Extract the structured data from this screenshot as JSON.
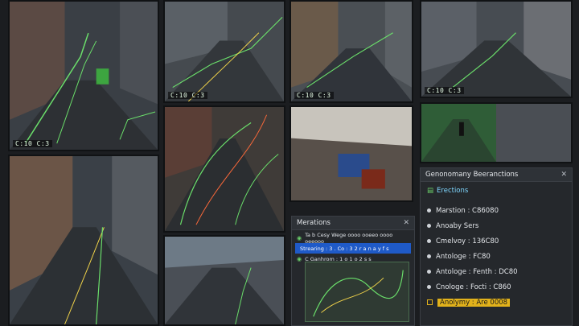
{
  "feeds": [
    {
      "id": "feed-1",
      "timestamp": "C:10 C:3",
      "label": ""
    },
    {
      "id": "feed-2",
      "timestamp": "C:10 C:3",
      "label": ""
    },
    {
      "id": "feed-3",
      "timestamp": "C:10 C:3",
      "label": ""
    },
    {
      "id": "feed-4",
      "timestamp": "C:10 C:3",
      "label": ""
    },
    {
      "id": "feed-5",
      "timestamp": "",
      "label": ""
    },
    {
      "id": "feed-6",
      "timestamp": "",
      "label": ""
    },
    {
      "id": "feed-7",
      "timestamp": "",
      "label": ""
    },
    {
      "id": "feed-8",
      "timestamp": "",
      "label": ""
    },
    {
      "id": "feed-9",
      "timestamp": "",
      "label": ""
    }
  ],
  "ops_panel": {
    "title": "Genonomany Beeranctions",
    "subtab": "Erections",
    "items": [
      {
        "label": "Marstion : C86080",
        "highlight": false
      },
      {
        "label": "Anoaby Sers",
        "highlight": false
      },
      {
        "label": "Cmelvoy : 136C80",
        "highlight": false
      },
      {
        "label": "Antologe : FC80",
        "highlight": false
      },
      {
        "label": "Antologe : Fenth : DC80",
        "highlight": false
      },
      {
        "label": "Cnologe : Focti : C860",
        "highlight": false
      },
      {
        "label": "Anolymy : Are 0008",
        "highlight": true
      }
    ]
  },
  "operations_popup": {
    "title": "Merations",
    "rows": [
      {
        "label": "Ta b Cesy Wege oooo ooeeo oooo oeeooo",
        "selected": false
      },
      {
        "label": "Strearing : 3 . Co : 3 2 r a n a y f s",
        "selected": true
      },
      {
        "label": "C Ganhrom : 1 o 1 o 2 s s",
        "selected": false
      }
    ]
  }
}
